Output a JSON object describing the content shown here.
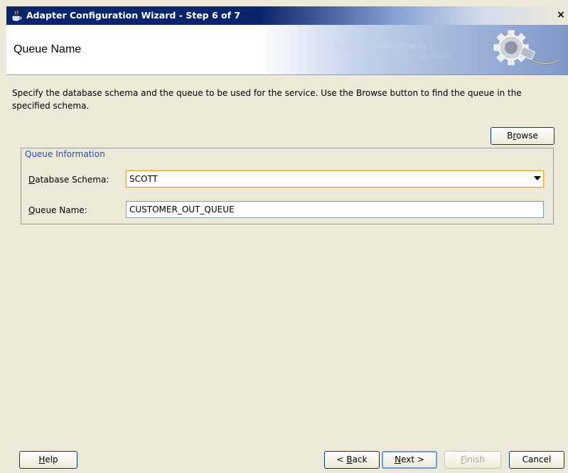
{
  "window": {
    "title": "Adapter Configuration Wizard - Step 6 of 7",
    "close_glyph": "×"
  },
  "header": {
    "title": "Queue Name",
    "binary_line1": "01010101010101010101010101",
    "binary_line2": "0101010101010"
  },
  "description": "Specify the database schema and the queue to be used for the service. Use the Browse button to find the queue in the specified schema.",
  "browse_button": {
    "label": "Browse",
    "mnemonic": "r"
  },
  "queue_info": {
    "legend": "Queue Information",
    "schema_label": "Database Schema:",
    "schema_value": "SCOTT",
    "queue_label": "Queue Name:",
    "queue_value": "CUSTOMER_OUT_QUEUE"
  },
  "footer": {
    "help": "Help",
    "back": "< Back",
    "next": "Next >",
    "finish": "Finish",
    "cancel": "Cancel"
  },
  "colors": {
    "title_bar": "#0a246a",
    "legend_text": "#2d4ea0",
    "focus_border": "#e8a830"
  },
  "icons": {
    "title": "coffee-cup-icon",
    "banner": "gear-plug-icon"
  }
}
